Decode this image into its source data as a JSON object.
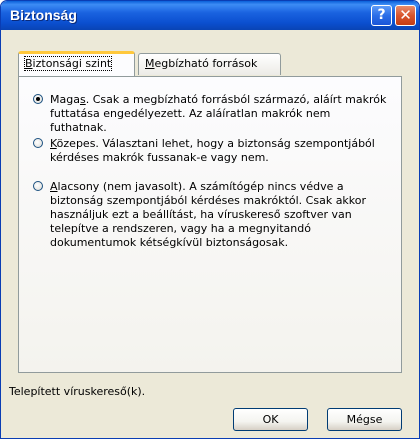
{
  "window": {
    "title": "Biztonság",
    "help_glyph": "?",
    "close_glyph": "✕"
  },
  "tabs": [
    {
      "label_prefix": "",
      "label_key": "B",
      "label_rest": "iztonsági szint",
      "active": true
    },
    {
      "label_prefix": "",
      "label_key": "M",
      "label_rest": "egbízható források",
      "active": false
    }
  ],
  "options": [
    {
      "checked": true,
      "label_prefix": "Maga",
      "label_key": "s",
      "label_rest": ". Csak a megbízható forrásból származó, aláírt makrók futtatása engedélyezett. Az aláíratlan makrók nem futhatnak."
    },
    {
      "checked": false,
      "label_prefix": "",
      "label_key": "K",
      "label_rest": "özepes. Választani lehet, hogy a biztonság szempontjából kérdéses makrók fussanak-e vagy nem."
    },
    {
      "checked": false,
      "label_prefix": "",
      "label_key": "A",
      "label_rest": "lacsony (nem javasolt). A számítógép nincs védve a biztonság szempontjából kérdéses makróktól. Csak akkor használjuk ezt a beállítást, ha víruskereső szoftver van telepítve a rendszeren, vagy ha a megnyitandó dokumentumok kétségkívül biztonságosak."
    }
  ],
  "footer": {
    "antivirus_label": "Telepített víruskereső(k)."
  },
  "buttons": {
    "ok": "OK",
    "cancel": "Mégse"
  }
}
